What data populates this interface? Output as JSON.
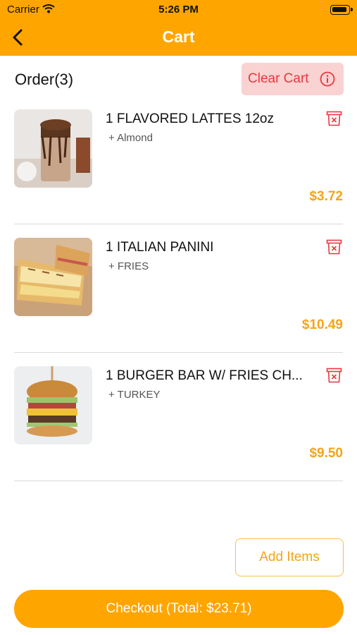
{
  "status": {
    "carrier": "Carrier",
    "time": "5:26 PM"
  },
  "nav": {
    "title": "Cart"
  },
  "order": {
    "title": "Order(3)",
    "clear_label": "Clear Cart"
  },
  "items": [
    {
      "name": "1 FLAVORED LATTES 12oz",
      "modifier": "+ Almond",
      "price": "$3.72"
    },
    {
      "name": "1 ITALIAN PANINI",
      "modifier": "+ FRIES",
      "price": "$10.49"
    },
    {
      "name": "1 BURGER BAR W/ FRIES CH...",
      "modifier": "+ TURKEY",
      "price": "$9.50"
    }
  ],
  "actions": {
    "add_items": "Add Items",
    "checkout": "Checkout (Total: $23.71)"
  },
  "colors": {
    "brand": "#FFA500",
    "price": "#F5A418",
    "danger": "#E8383D",
    "danger_bg": "#F9D2D2"
  }
}
